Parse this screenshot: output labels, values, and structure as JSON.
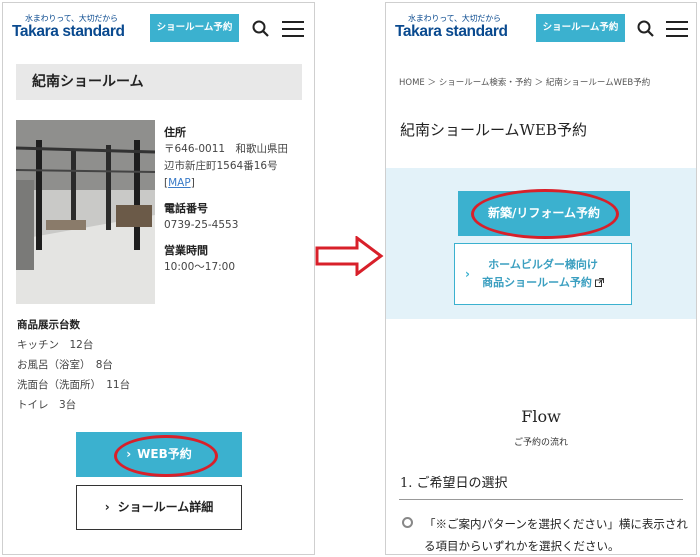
{
  "header": {
    "tagline": "水まわりって、大切だから",
    "logo": "Takara standard",
    "reserve_label": "ショールーム予約"
  },
  "left_page": {
    "title": "紀南ショールーム",
    "address_label": "住所",
    "address_line1": "〒646-0011　和歌山県田",
    "address_line2": "辺市新庄町1564番16号",
    "map_open": "[",
    "map_link": "MAP",
    "map_close": "]",
    "phone_label": "電話番号",
    "phone": "0739-25-4553",
    "hours_label": "営業時間",
    "hours": "10:00〜17:00",
    "counts_label": "商品展示台数",
    "counts": [
      "キッチン　12台",
      "お風呂（浴室）　8台",
      "洗面台（洗面所）　11台",
      "トイレ　3台"
    ],
    "web_button": "WEB予約",
    "detail_button": "ショールーム詳細"
  },
  "right_page": {
    "breadcrumb": "HOME ＞ ショールーム検索・予約 ＞ 紀南ショールームWEB予約",
    "title": "紀南ショールームWEB予約",
    "new_button": "新築/リフォーム予約",
    "hb_button_line1": "ホームビルダー様向け",
    "hb_button_line2": "商品ショールーム予約",
    "flow_title": "Flow",
    "flow_subtitle": "ご予約の流れ",
    "step_title": "1.  ご希望日の選択",
    "step_text": "「※ご案内パターンを選択ください」横に表示される項目からいずれかを選択ください。"
  },
  "colors": {
    "accent": "#3bb1cf",
    "brand": "#0a4a8f",
    "highlight": "#d8202a"
  }
}
